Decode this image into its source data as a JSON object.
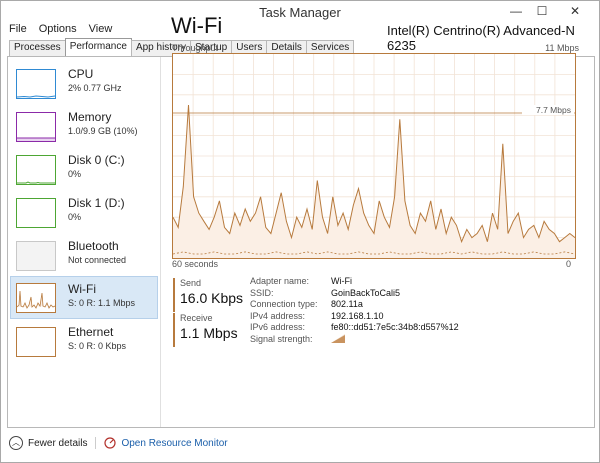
{
  "window": {
    "title": "Task Manager"
  },
  "menu": [
    "File",
    "Options",
    "View"
  ],
  "tabs": [
    {
      "label": "Processes"
    },
    {
      "label": "Performance",
      "active": true
    },
    {
      "label": "App history"
    },
    {
      "label": "Startup"
    },
    {
      "label": "Users"
    },
    {
      "label": "Details"
    },
    {
      "label": "Services"
    }
  ],
  "sidebar": [
    {
      "label": "CPU",
      "sub": "2% 0.77 GHz",
      "color": "#2f8ad3"
    },
    {
      "label": "Memory",
      "sub": "1.0/9.9 GB (10%)",
      "color": "#8b2aa8"
    },
    {
      "label": "Disk 0 (C:)",
      "sub": "0%",
      "color": "#4da633"
    },
    {
      "label": "Disk 1 (D:)",
      "sub": "0%",
      "color": "#4da633"
    },
    {
      "label": "Bluetooth",
      "sub": "Not connected",
      "color": "#c8c8c8"
    },
    {
      "label": "Wi-Fi",
      "sub": "S: 0 R: 1.1 Mbps",
      "color": "#b77a3d",
      "selected": true
    },
    {
      "label": "Ethernet",
      "sub": "S: 0 R: 0 Kbps",
      "color": "#b77a3d"
    }
  ],
  "main": {
    "title": "Wi-Fi",
    "adapter": "Intel(R) Centrino(R) Advanced-N 6235",
    "graph_label": "Throughput",
    "graph_max": "11 Mbps",
    "graph_ref": "7.7 Mbps",
    "time_left": "60 seconds",
    "time_right": "0",
    "throughput_trace": [
      0.2,
      0.15,
      0.35,
      0.75,
      0.3,
      0.22,
      0.18,
      0.14,
      0.2,
      0.28,
      0.15,
      0.12,
      0.22,
      0.16,
      0.24,
      0.18,
      0.22,
      0.3,
      0.15,
      0.12,
      0.22,
      0.32,
      0.18,
      0.1,
      0.2,
      0.15,
      0.24,
      0.14,
      0.38,
      0.2,
      0.12,
      0.3,
      0.16,
      0.22,
      0.14,
      0.26,
      0.34,
      0.22,
      0.16,
      0.12,
      0.28,
      0.2,
      0.15,
      0.3,
      0.68,
      0.28,
      0.16,
      0.12,
      0.22,
      0.18,
      0.28,
      0.14,
      0.24,
      0.12,
      0.2,
      0.16,
      0.08,
      0.14,
      0.1,
      0.12,
      0.16,
      0.08,
      0.22,
      0.14,
      0.56,
      0.12,
      0.18,
      0.22,
      0.1,
      0.14,
      0.16,
      0.1,
      0.18,
      0.14,
      0.12,
      0.08,
      0.1,
      0.12,
      0.1
    ],
    "send_trace": [
      0.01,
      0.02,
      0.01,
      0.01,
      0.02,
      0.01,
      0.01,
      0.02,
      0.01,
      0.01,
      0.02,
      0.01,
      0.01,
      0.02,
      0.01,
      0.02,
      0.01,
      0.01,
      0.02,
      0.01,
      0.01,
      0.02,
      0.01,
      0.01,
      0.02,
      0.01,
      0.01,
      0.02,
      0.01,
      0.02,
      0.01,
      0.01,
      0.02,
      0.01,
      0.01,
      0.02,
      0.01,
      0.01,
      0.02,
      0.01
    ]
  },
  "send": {
    "label": "Send",
    "value": "16.0 Kbps"
  },
  "receive": {
    "label": "Receive",
    "value": "1.1 Mbps"
  },
  "details": [
    {
      "key": "Adapter name:",
      "value": "Wi-Fi"
    },
    {
      "key": "SSID:",
      "value": "GoinBackToCali5"
    },
    {
      "key": "Connection type:",
      "value": "802.11a"
    },
    {
      "key": "IPv4 address:",
      "value": "192.168.1.10"
    },
    {
      "key": "IPv6 address:",
      "value": "fe80::dd51:7e5c:34b8:d557%12"
    },
    {
      "key": "Signal strength:",
      "signal_bars": 4
    }
  ],
  "footer": {
    "fewer_details": "Fewer details",
    "open_resource_monitor": "Open Resource Monitor"
  },
  "colors": {
    "wifi": "#b77a3d",
    "grid": "#f2e3d6",
    "fill": "#fbefe5"
  }
}
